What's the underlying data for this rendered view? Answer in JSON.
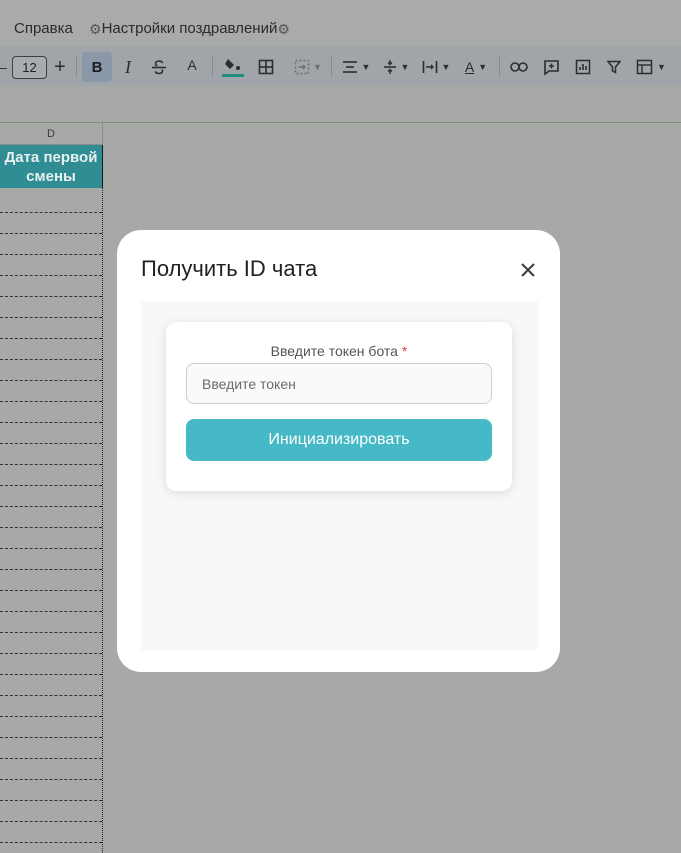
{
  "menubar": {
    "help_label": "Справка",
    "congrats_settings_label": "Настройки поздравлений"
  },
  "toolbar": {
    "font_size": "12",
    "bold_label": "B",
    "italic_label": "I",
    "text_color_label": "A",
    "text_color_accent": "#1e8c7e",
    "fill_color_accent": "#1e8c7e"
  },
  "sheet": {
    "column_label": "D",
    "header_cell_text": "Дата первой смены",
    "header_cell_color": "#2f8d93"
  },
  "modal": {
    "title": "Получить ID чата",
    "close_icon": "close-icon",
    "field_label": "Введите токен бота",
    "required_mark": "*",
    "input_value": "",
    "input_placeholder": "Введите токен",
    "submit_label": "Инициализировать",
    "accent_color": "#46b9c6"
  }
}
